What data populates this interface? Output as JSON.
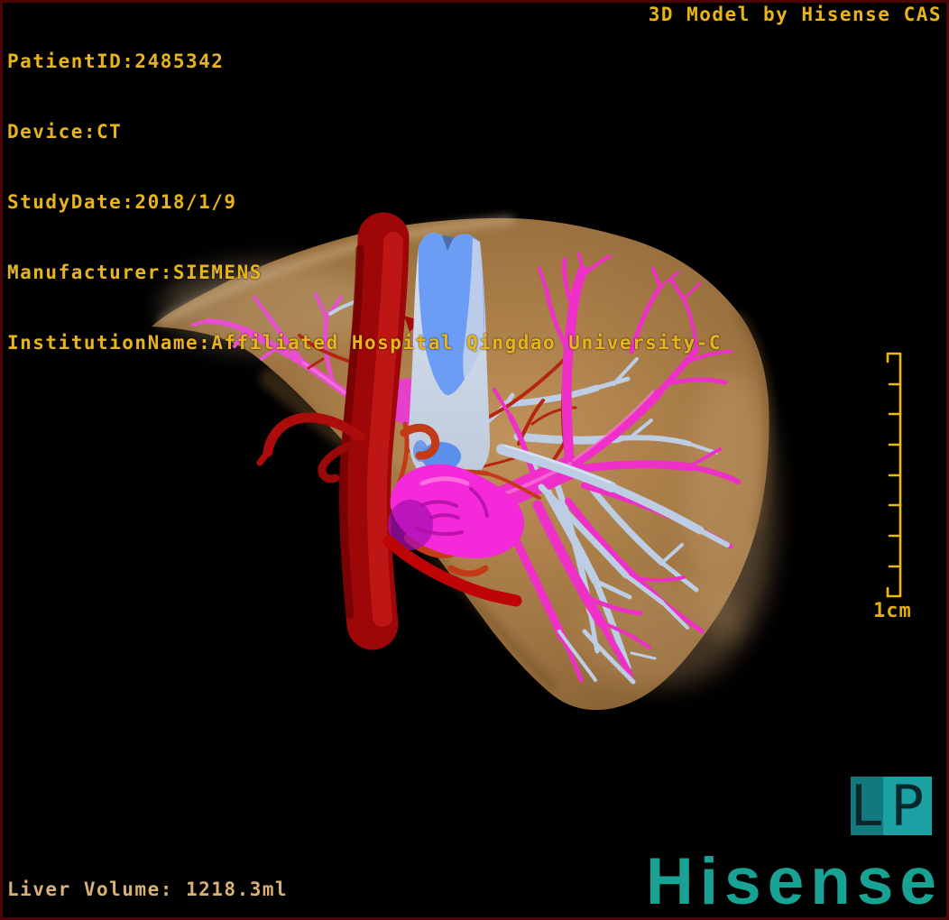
{
  "annotations": {
    "patient_lines": [
      "PatientID:2485342",
      "Device:CT",
      "StudyDate:2018/1/9",
      "Manufacturer:SIEMENS",
      "InstitutionName:Affiliated Hospital Qingdao University-C"
    ],
    "credit": "3D Model by Hisense CAS",
    "liver_volume": "Liver Volume: 1218.3ml",
    "scale_label": "1cm"
  },
  "orientation_marker": {
    "left": "L",
    "right": "P"
  },
  "branding": {
    "logo": "Hisense"
  },
  "legend_colors": {
    "liver": "#A87C47",
    "aorta": "#A50A0A",
    "inferior_vena_cava": "#6B9DF4",
    "portal_vein": "#EE30C8",
    "hepatic_vein": "#BCCDE4",
    "hepatic_artery": "#B5250F",
    "annotation_text": "#E8B41D",
    "volume_text": "#D8B175",
    "scale_bar": "#EDB90A",
    "brand_teal": "#18A294",
    "badge_dark": "#117A7E",
    "badge_light": "#1BA0A4",
    "frame": "#4E0505",
    "background": "#000000"
  }
}
